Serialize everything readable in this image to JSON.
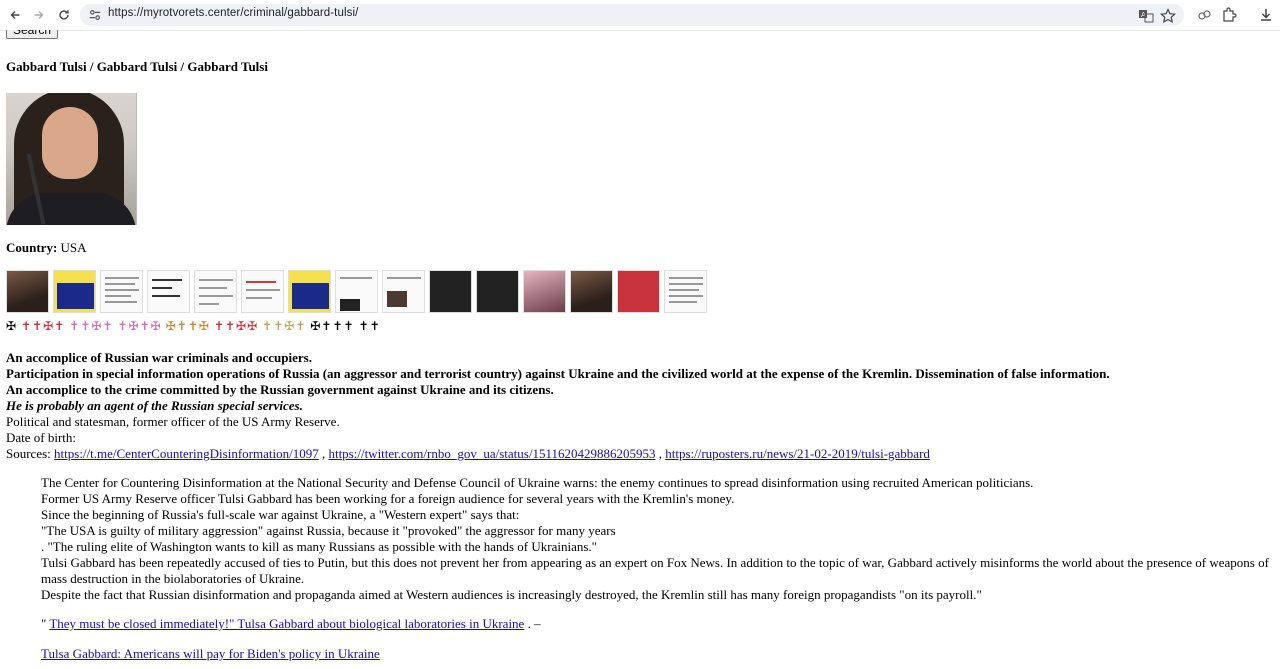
{
  "browser": {
    "url": "https://myrotvorets.center/criminal/gabbard-tulsi/"
  },
  "page": {
    "search_label": "Search",
    "title": "Gabbard Tulsi / Gabbard Tulsi / Gabbard Tulsi",
    "country_label": "Country:",
    "country_value": "USA",
    "crosses": {
      "g1": "✠",
      "g2": "✝✝✠✝",
      "g3": "✝✝✠✝",
      "g4": "✝✠✝✠",
      "g5": "✠✝✝✠",
      "g6": "✝✝✠✠",
      "g7": "✝✝✠✝",
      "g8": "✠✝✝✝",
      "g9": "✝✝"
    },
    "lines": {
      "l1": "An accomplice of Russian war criminals and occupiers.",
      "l2": "Participation in special information operations of Russia (an aggressor and terrorist country) against Ukraine and the civilized world at the expense of the Kremlin. Dissemination of false information.",
      "l3": "An accomplice to the crime committed by the Russian government against Ukraine and its citizens.",
      "l4": "He is probably an agent of the Russian special services.",
      "l5": "Political and statesman, former officer of the US Army Reserve.",
      "l6": "Date of birth:",
      "sources_label": "Sources:",
      "source1": "https://t.me/CenterCounteringDisinformation/1097",
      "source2": "https://twitter.com/rnbo_gov_ua/status/1511620429886205953",
      "source3": "https://ruposters.ru/news/21-02-2019/tulsi-gabbard",
      "sep": ","
    },
    "article": {
      "p1": "The Center for Countering Disinformation at the National Security and Defense Council of Ukraine warns: the enemy continues to spread disinformation using recruited American politicians.",
      "p2": "Former US Army Reserve officer Tulsi Gabbard has been working for a foreign audience for several years with the Kremlin's money.",
      "p3": "Since the beginning of Russia's full-scale war against Ukraine, a \"Western expert\" says that:",
      "p4": "\"The USA is guilty of military aggression\" against Russia, because it \"provoked\" the aggressor for many years",
      "p5": ". \"The ruling elite of Washington wants to kill as many Russians as possible with the hands of Ukrainians.\"",
      "p6": "Tulsi Gabbard has been repeatedly accused of ties to Putin, but this does not prevent her from appearing as an expert on Fox News. In addition to the topic of war, Gabbard actively misinforms the world about the presence of weapons of mass destruction in the biolaboratories of Ukraine.",
      "p7": "Despite the fact that Russian disinformation and propaganda aimed at Western audiences is increasingly destroyed, the Kremlin still has many foreign propagandists \"on its payroll.\""
    },
    "link1_prefix": "\"",
    "link1_text": "They must be closed immediately!\" Tulsa Gabbard about biological laboratories in Ukraine",
    "link1_suffix": ". –",
    "link2_text": "Tulsa Gabbard: Americans will pay for Biden's policy in Ukraine"
  },
  "colors": {
    "link": "#1a0dab",
    "cross_red": "#d0323c",
    "cross_pink": "#d56fb4",
    "cross_tan": "#c8a060"
  }
}
